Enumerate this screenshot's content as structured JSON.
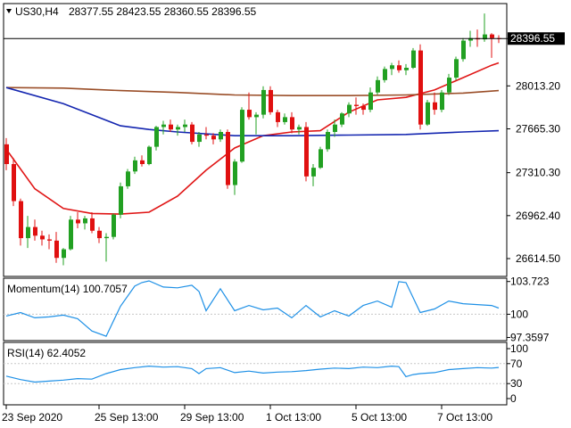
{
  "header": {
    "symbol_label": "US30,H4",
    "ohlc": "28377.55 28423.55 28360.55 28396.55",
    "current_price": "28396.55"
  },
  "colors": {
    "bull": "#22a022",
    "bear": "#e01010",
    "ma_fast": "#e01515",
    "ma_mid": "#9a4e28",
    "ma_slow": "#1426b0",
    "indicator_line": "#1e90e6",
    "grid": "#c8c8c8",
    "frame": "#000000"
  },
  "chart_data": [
    {
      "type": "candlestick",
      "title": "US30,H4",
      "price_axis_ticks": [
        "28396.55",
        "28013.20",
        "27665.30",
        "27310.30",
        "26962.40",
        "26614.50"
      ],
      "price_axis_values": [
        28396.55,
        28013.2,
        27665.3,
        27310.3,
        26962.4,
        26614.5
      ],
      "ylim": [
        26470,
        28680
      ],
      "x_tick_labels": [
        "23 Sep 2020",
        "25 Sep 13:00",
        "29 Sep 13:00",
        "1 Oct 13:00",
        "5 Oct 13:00",
        "7 Oct 13:00"
      ],
      "x_tick_bar_index": [
        0,
        13,
        25,
        37,
        49,
        61
      ],
      "candles": [
        [
          27540,
          27590,
          27330,
          27380
        ],
        [
          27380,
          27430,
          27040,
          27080
        ],
        [
          27080,
          27100,
          26720,
          26780
        ],
        [
          26780,
          26960,
          26700,
          26870
        ],
        [
          26870,
          26930,
          26760,
          26800
        ],
        [
          26800,
          26840,
          26720,
          26770
        ],
        [
          26770,
          26810,
          26690,
          26760
        ],
        [
          26760,
          26830,
          26580,
          26620
        ],
        [
          26620,
          26700,
          26560,
          26690
        ],
        [
          26690,
          26960,
          26680,
          26930
        ],
        [
          26930,
          26990,
          26860,
          26900
        ],
        [
          26900,
          26960,
          26850,
          26940
        ],
        [
          26940,
          26990,
          26820,
          26840
        ],
        [
          26840,
          26870,
          26740,
          26780
        ],
        [
          26780,
          26820,
          26590,
          26790
        ],
        [
          26790,
          26980,
          26770,
          26970
        ],
        [
          26970,
          27230,
          26940,
          27200
        ],
        [
          27200,
          27340,
          27180,
          27320
        ],
        [
          27320,
          27440,
          27300,
          27410
        ],
        [
          27410,
          27450,
          27360,
          27380
        ],
        [
          27380,
          27530,
          27370,
          27520
        ],
        [
          27520,
          27690,
          27490,
          27680
        ],
        [
          27680,
          27730,
          27620,
          27700
        ],
        [
          27700,
          27740,
          27640,
          27660
        ],
        [
          27660,
          27700,
          27610,
          27680
        ],
        [
          27680,
          27740,
          27640,
          27700
        ],
        [
          27700,
          27720,
          27540,
          27560
        ],
        [
          27560,
          27640,
          27520,
          27620
        ],
        [
          27620,
          27680,
          27580,
          27610
        ],
        [
          27610,
          27630,
          27540,
          27580
        ],
        [
          27580,
          27660,
          27560,
          27640
        ],
        [
          27640,
          27660,
          27180,
          27210
        ],
        [
          27210,
          27420,
          27130,
          27400
        ],
        [
          27400,
          27840,
          27390,
          27820
        ],
        [
          27820,
          27960,
          27740,
          27760
        ],
        [
          27760,
          27800,
          27620,
          27780
        ],
        [
          27780,
          28010,
          27750,
          27980
        ],
        [
          27980,
          28010,
          27780,
          27800
        ],
        [
          27800,
          27820,
          27680,
          27720
        ],
        [
          27720,
          27790,
          27700,
          27760
        ],
        [
          27760,
          27800,
          27630,
          27660
        ],
        [
          27660,
          27700,
          27620,
          27680
        ],
        [
          27680,
          27720,
          27240,
          27280
        ],
        [
          27280,
          27380,
          27200,
          27350
        ],
        [
          27350,
          27520,
          27340,
          27500
        ],
        [
          27500,
          27660,
          27480,
          27640
        ],
        [
          27640,
          27740,
          27600,
          27700
        ],
        [
          27700,
          27800,
          27680,
          27790
        ],
        [
          27790,
          27880,
          27760,
          27860
        ],
        [
          27860,
          27920,
          27780,
          27850
        ],
        [
          27850,
          27870,
          27780,
          27820
        ],
        [
          27820,
          28000,
          27800,
          27960
        ],
        [
          27960,
          28090,
          27940,
          28060
        ],
        [
          28060,
          28170,
          28040,
          28150
        ],
        [
          28150,
          28200,
          28100,
          28180
        ],
        [
          28180,
          28220,
          28120,
          28140
        ],
        [
          28140,
          28190,
          28100,
          28160
        ],
        [
          28160,
          28320,
          28150,
          28300
        ],
        [
          28300,
          28350,
          27660,
          27700
        ],
        [
          27700,
          27900,
          27690,
          27880
        ],
        [
          27880,
          27960,
          27780,
          27820
        ],
        [
          27820,
          27980,
          27800,
          27960
        ],
        [
          27960,
          28110,
          27940,
          28080
        ],
        [
          28080,
          28250,
          28060,
          28230
        ],
        [
          28230,
          28400,
          28210,
          28380
        ],
        [
          28380,
          28460,
          28330,
          28400
        ],
        [
          28400,
          28470,
          28330,
          28390
        ],
        [
          28390,
          28600,
          28370,
          28430
        ],
        [
          28430,
          28440,
          28240,
          28400
        ],
        [
          28400,
          28423.55,
          28360.55,
          28396.55
        ]
      ],
      "series": [
        {
          "name": "",
          "color_key": "ma_fast",
          "x": [
            0,
            4,
            8,
            12,
            16,
            20,
            24,
            28,
            32,
            36,
            40,
            44,
            48,
            52,
            56,
            60,
            64,
            68,
            69
          ],
          "values": [
            27500,
            27180,
            27020,
            26980,
            26975,
            26990,
            27120,
            27330,
            27510,
            27610,
            27640,
            27650,
            27800,
            27900,
            27920,
            27980,
            28080,
            28180,
            28200
          ]
        },
        {
          "name": "",
          "color_key": "ma_mid",
          "x": [
            0,
            8,
            16,
            24,
            32,
            40,
            48,
            56,
            64,
            69
          ],
          "values": [
            28000,
            27995,
            27975,
            27960,
            27940,
            27935,
            27935,
            27940,
            27955,
            27975
          ]
        },
        {
          "name": "",
          "color_key": "ma_slow",
          "x": [
            0,
            8,
            16,
            20,
            24,
            32,
            40,
            48,
            56,
            64,
            69
          ],
          "values": [
            28000,
            27870,
            27690,
            27660,
            27640,
            27610,
            27610,
            27615,
            27620,
            27640,
            27650
          ]
        }
      ]
    },
    {
      "type": "line",
      "title": "Momentum(14) 100.7057",
      "y_ticks": [
        "103.723",
        "100",
        "97.3597"
      ],
      "y_tick_values": [
        103.723,
        100,
        97.3597
      ],
      "ylim": [
        97.0,
        104.1
      ],
      "reference_line": 100,
      "x": [
        0,
        2,
        4,
        6,
        8,
        10,
        12,
        14,
        16,
        18,
        19,
        20,
        22,
        24,
        26,
        27,
        28,
        30,
        32,
        34,
        36,
        38,
        40,
        42,
        44,
        46,
        48,
        50,
        52,
        54,
        55,
        56,
        58,
        60,
        62,
        64,
        66,
        68,
        69
      ],
      "values": [
        99.8,
        100.2,
        99.6,
        99.7,
        99.9,
        99.5,
        98.1,
        97.5,
        100.9,
        103.2,
        103.6,
        103.8,
        103.1,
        103.0,
        103.3,
        102.6,
        100.4,
        102.9,
        100.4,
        101.0,
        100.5,
        100.7,
        99.6,
        101.0,
        99.7,
        100.4,
        99.8,
        101.0,
        101.5,
        100.8,
        103.7,
        103.6,
        100.2,
        100.6,
        101.5,
        101.2,
        101.1,
        101.0,
        100.7057
      ]
    },
    {
      "type": "line",
      "title": "RSI(14) 62.4052",
      "y_ticks": [
        "100",
        "70",
        "30",
        "0"
      ],
      "y_tick_values": [
        100,
        70,
        30,
        0
      ],
      "ylim": [
        0,
        100
      ],
      "levels": [
        70,
        30
      ],
      "x": [
        0,
        2,
        4,
        6,
        8,
        10,
        12,
        14,
        16,
        18,
        20,
        22,
        24,
        26,
        27,
        28,
        30,
        32,
        34,
        36,
        38,
        40,
        42,
        44,
        46,
        48,
        50,
        52,
        54,
        55,
        56,
        57,
        58,
        60,
        62,
        64,
        66,
        68,
        69
      ],
      "values": [
        45,
        38,
        33,
        35,
        37,
        40,
        39,
        50,
        58,
        62,
        65,
        63,
        64,
        60,
        50,
        60,
        62,
        52,
        55,
        51,
        53,
        54,
        56,
        59,
        61,
        60,
        63,
        62,
        65,
        64,
        44,
        48,
        50,
        52,
        58,
        60,
        62,
        61,
        62.4052
      ]
    }
  ]
}
